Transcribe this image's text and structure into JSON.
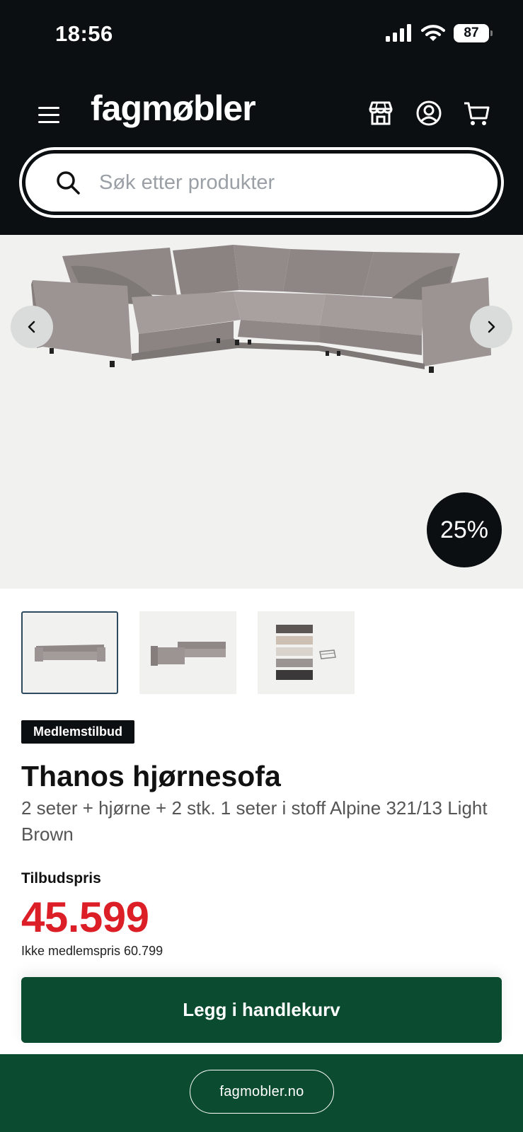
{
  "status_bar": {
    "time": "18:56",
    "battery": "87"
  },
  "header": {
    "logo": "fagmøbler"
  },
  "search": {
    "placeholder": "Søk etter produkter"
  },
  "hero": {
    "discount": "25%"
  },
  "product": {
    "badge": "Medlemstilbud",
    "title": "Thanos hjørnesofa",
    "subtitle": "2 seter + hjørne + 2 stk. 1 seter i stoff Alpine 321/13 Light Brown",
    "price_label": "Tilbudspris",
    "price": "45.599",
    "member_price": "Ikke medlemspris 60.799"
  },
  "actions": {
    "add_to_cart": "Legg i handlekurv"
  },
  "browser": {
    "url": "fagmobler.no"
  },
  "colors": {
    "header_bg": "#0b0f12",
    "price_red": "#dc1f26",
    "brand_green": "#0b4b2f",
    "hero_bg": "#f1f1f0"
  },
  "icons": [
    "menu-icon",
    "store-icon",
    "account-icon",
    "cart-icon",
    "search-icon",
    "chevron-left-icon",
    "chevron-right-icon"
  ]
}
